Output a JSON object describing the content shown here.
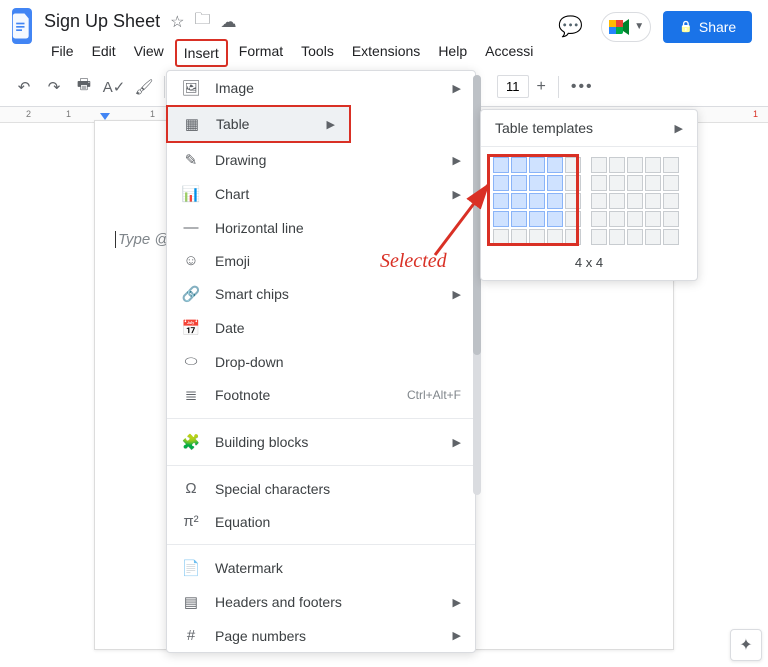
{
  "doc": {
    "title": "Sign Up Sheet"
  },
  "menubar": [
    "File",
    "Edit",
    "View",
    "Insert",
    "Format",
    "Tools",
    "Extensions",
    "Help",
    "Accessi"
  ],
  "menubar_active_index": 3,
  "share_label": "Share",
  "toolbar": {
    "font_size": "11"
  },
  "ruler_ticks": [
    "2",
    "1",
    "",
    "1"
  ],
  "placeholder": "Type @ t",
  "insert_menu": [
    {
      "icon": "🖼",
      "label": "Image",
      "arrow": true
    },
    {
      "icon": "▦",
      "label": "Table",
      "arrow": true,
      "highlight": true
    },
    {
      "icon": "✎",
      "label": "Drawing",
      "arrow": true
    },
    {
      "icon": "📊",
      "label": "Chart",
      "arrow": true
    },
    {
      "icon": "—",
      "label": "Horizontal line"
    },
    {
      "icon": "☺",
      "label": "Emoji"
    },
    {
      "icon": "🔗",
      "label": "Smart chips",
      "arrow": true
    },
    {
      "icon": "📅",
      "label": "Date"
    },
    {
      "icon": "⬭",
      "label": "Drop-down"
    },
    {
      "icon": "≣",
      "label": "Footnote",
      "short": "Ctrl+Alt+F"
    },
    {
      "sep": true
    },
    {
      "icon": "🧩",
      "label": "Building blocks",
      "arrow": true
    },
    {
      "sep": true
    },
    {
      "icon": "Ω",
      "label": "Special characters"
    },
    {
      "icon": "π²",
      "label": "Equation"
    },
    {
      "sep": true
    },
    {
      "icon": "📄",
      "label": "Watermark"
    },
    {
      "icon": "▤",
      "label": "Headers and footers",
      "arrow": true
    },
    {
      "icon": "#",
      "label": "Page numbers",
      "arrow": true
    }
  ],
  "table_submenu": {
    "title": "Table templates",
    "grid_size": 5,
    "selected": {
      "rows": 4,
      "cols": 4
    },
    "dim_label": "4 x 4"
  },
  "annotation": {
    "text": "Selected"
  }
}
